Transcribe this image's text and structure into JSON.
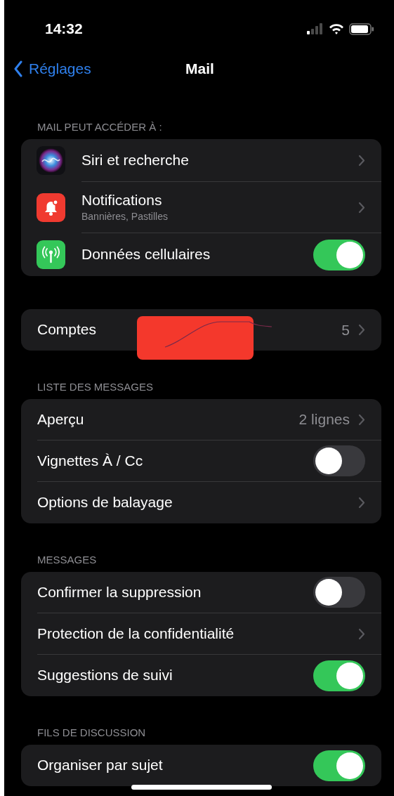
{
  "status_bar": {
    "time": "14:32"
  },
  "nav": {
    "back": "Réglages",
    "title": "Mail"
  },
  "sections": [
    {
      "header": "MAIL PEUT ACCÉDER À :",
      "rows": [
        {
          "kind": "link",
          "label": "Siri et recherche"
        },
        {
          "kind": "link",
          "label": "Notifications",
          "subtitle": "Bannières, Pastilles"
        },
        {
          "kind": "toggle",
          "label": "Données cellulaires",
          "on": true
        }
      ]
    },
    {
      "rows": [
        {
          "kind": "link",
          "label": "Comptes",
          "value": "5",
          "redacted": true
        }
      ]
    },
    {
      "header": "LISTE DES MESSAGES",
      "rows": [
        {
          "kind": "link",
          "label": "Aperçu",
          "value": "2 lignes"
        },
        {
          "kind": "toggle",
          "label": "Vignettes À / Cc",
          "on": false
        },
        {
          "kind": "link",
          "label": "Options de balayage"
        }
      ]
    },
    {
      "header": "MESSAGES",
      "rows": [
        {
          "kind": "toggle",
          "label": "Confirmer la suppression",
          "on": false
        },
        {
          "kind": "link",
          "label": "Protection de la confidentialité"
        },
        {
          "kind": "toggle",
          "label": "Suggestions de suivi",
          "on": true
        }
      ]
    },
    {
      "header": "FILS DE DISCUSSION",
      "rows": [
        {
          "kind": "toggle",
          "label": "Organiser par sujet",
          "on": true
        }
      ]
    }
  ]
}
